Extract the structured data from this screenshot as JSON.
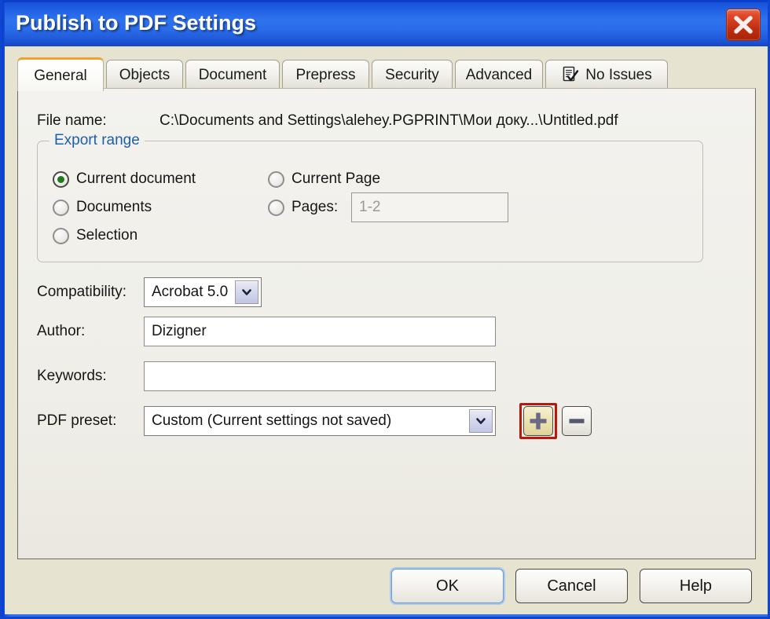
{
  "window": {
    "title": "Publish to PDF Settings",
    "close_icon": "close-icon",
    "accent_titlebar": "#2f6fe8",
    "dialog_background": "#e6e3d0"
  },
  "tabs": [
    {
      "label": "General",
      "active": true
    },
    {
      "label": "Objects",
      "active": false
    },
    {
      "label": "Document",
      "active": false
    },
    {
      "label": "Prepress",
      "active": false
    },
    {
      "label": "Security",
      "active": false
    },
    {
      "label": "Advanced",
      "active": false
    },
    {
      "label": "No Issues",
      "active": false,
      "icon": "document-check-icon"
    }
  ],
  "general": {
    "file_name_label": "File name:",
    "file_name_value": "C:\\Documents and Settings\\alehey.PGPRINT\\Мои доку...\\Untitled.pdf",
    "export_range": {
      "title": "Export range",
      "title_color": "#1f5fa8",
      "options_left": [
        {
          "label": "Current document",
          "checked": true,
          "enabled": true
        },
        {
          "label": "Documents",
          "checked": false,
          "enabled": false
        },
        {
          "label": "Selection",
          "checked": false,
          "enabled": false
        }
      ],
      "options_right": [
        {
          "label": "Current Page",
          "checked": false,
          "enabled": false
        },
        {
          "label": "Pages:",
          "checked": false,
          "enabled": false
        }
      ],
      "pages_value": "1-2",
      "pages_enabled": false
    },
    "compatibility_label": "Compatibility:",
    "compatibility_value": "Acrobat 5.0",
    "author_label": "Author:",
    "author_value": "Dizigner",
    "keywords_label": "Keywords:",
    "keywords_value": "",
    "pdf_preset_label": "PDF preset:",
    "pdf_preset_value": "Custom (Current settings not saved)",
    "preset_add_icon": "plus-icon",
    "preset_remove_icon": "minus-icon",
    "highlight_color": "#b8190f"
  },
  "footer": {
    "ok_label": "OK",
    "cancel_label": "Cancel",
    "help_label": "Help"
  }
}
